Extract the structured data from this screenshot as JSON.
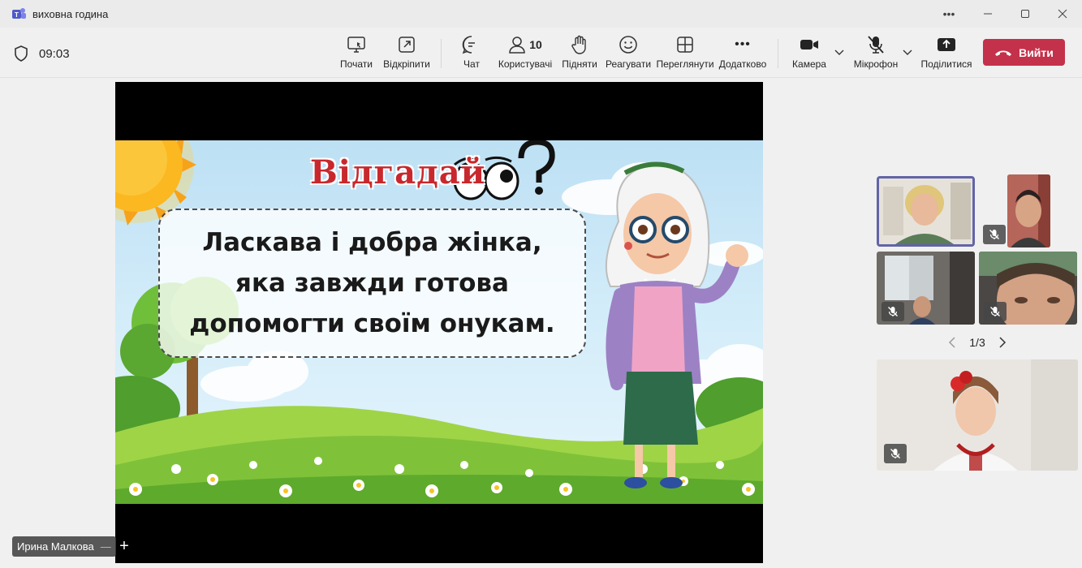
{
  "window": {
    "title": "виховна година",
    "controls": [
      "more-options",
      "minimize",
      "maximize",
      "close"
    ]
  },
  "toolbar": {
    "timer": "09:03",
    "items": {
      "share_start": "Почати",
      "pop_out": "Відкріпити",
      "chat": "Чат",
      "people": "Користувачі",
      "people_count": "10",
      "raise_hand": "Підняти",
      "react": "Реагувати",
      "view": "Переглянути",
      "more": "Додатково",
      "camera": "Камера",
      "mic": "Мікрофон",
      "share": "Поділитися"
    },
    "leave_label": "Вийти",
    "leave_color": "#c4314b"
  },
  "stage": {
    "slide_title": "Відгадай",
    "slide_text": "Ласкава і добра жінка, яка завжди готова допомогти своїм онукам.",
    "presenter_name": "Ирина Малкова",
    "add_label": "+"
  },
  "participants": {
    "tiles": [
      {
        "id": "p1",
        "muted": false,
        "active_speaker": true
      },
      {
        "id": "p2",
        "muted": true
      },
      {
        "id": "p3",
        "muted": true
      },
      {
        "id": "p4",
        "muted": true
      },
      {
        "id": "p5",
        "muted": true
      }
    ],
    "pager": {
      "current": 1,
      "total": 3,
      "label": "1/3"
    }
  },
  "icons": [
    "teams-icon",
    "shield-icon",
    "share-screen-icon",
    "pop-out-icon",
    "chat-icon",
    "people-icon",
    "raise-hand-icon",
    "react-icon",
    "view-icon",
    "more-icon",
    "camera-icon",
    "mic-off-icon",
    "share-tray-icon",
    "phone-hangup-icon"
  ]
}
